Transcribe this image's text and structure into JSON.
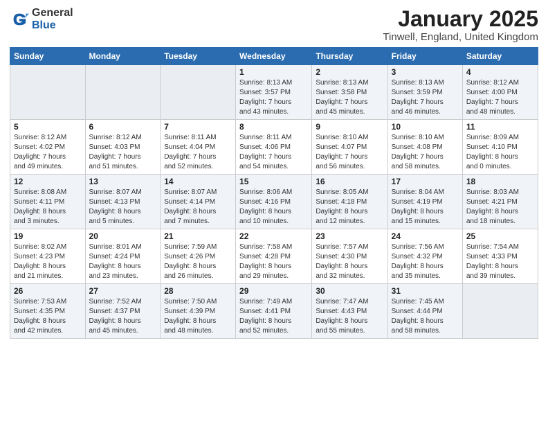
{
  "header": {
    "logo_general": "General",
    "logo_blue": "Blue",
    "month": "January 2025",
    "location": "Tinwell, England, United Kingdom"
  },
  "days_of_week": [
    "Sunday",
    "Monday",
    "Tuesday",
    "Wednesday",
    "Thursday",
    "Friday",
    "Saturday"
  ],
  "weeks": [
    [
      {
        "day": "",
        "info": ""
      },
      {
        "day": "",
        "info": ""
      },
      {
        "day": "",
        "info": ""
      },
      {
        "day": "1",
        "info": "Sunrise: 8:13 AM\nSunset: 3:57 PM\nDaylight: 7 hours\nand 43 minutes."
      },
      {
        "day": "2",
        "info": "Sunrise: 8:13 AM\nSunset: 3:58 PM\nDaylight: 7 hours\nand 45 minutes."
      },
      {
        "day": "3",
        "info": "Sunrise: 8:13 AM\nSunset: 3:59 PM\nDaylight: 7 hours\nand 46 minutes."
      },
      {
        "day": "4",
        "info": "Sunrise: 8:12 AM\nSunset: 4:00 PM\nDaylight: 7 hours\nand 48 minutes."
      }
    ],
    [
      {
        "day": "5",
        "info": "Sunrise: 8:12 AM\nSunset: 4:02 PM\nDaylight: 7 hours\nand 49 minutes."
      },
      {
        "day": "6",
        "info": "Sunrise: 8:12 AM\nSunset: 4:03 PM\nDaylight: 7 hours\nand 51 minutes."
      },
      {
        "day": "7",
        "info": "Sunrise: 8:11 AM\nSunset: 4:04 PM\nDaylight: 7 hours\nand 52 minutes."
      },
      {
        "day": "8",
        "info": "Sunrise: 8:11 AM\nSunset: 4:06 PM\nDaylight: 7 hours\nand 54 minutes."
      },
      {
        "day": "9",
        "info": "Sunrise: 8:10 AM\nSunset: 4:07 PM\nDaylight: 7 hours\nand 56 minutes."
      },
      {
        "day": "10",
        "info": "Sunrise: 8:10 AM\nSunset: 4:08 PM\nDaylight: 7 hours\nand 58 minutes."
      },
      {
        "day": "11",
        "info": "Sunrise: 8:09 AM\nSunset: 4:10 PM\nDaylight: 8 hours\nand 0 minutes."
      }
    ],
    [
      {
        "day": "12",
        "info": "Sunrise: 8:08 AM\nSunset: 4:11 PM\nDaylight: 8 hours\nand 3 minutes."
      },
      {
        "day": "13",
        "info": "Sunrise: 8:07 AM\nSunset: 4:13 PM\nDaylight: 8 hours\nand 5 minutes."
      },
      {
        "day": "14",
        "info": "Sunrise: 8:07 AM\nSunset: 4:14 PM\nDaylight: 8 hours\nand 7 minutes."
      },
      {
        "day": "15",
        "info": "Sunrise: 8:06 AM\nSunset: 4:16 PM\nDaylight: 8 hours\nand 10 minutes."
      },
      {
        "day": "16",
        "info": "Sunrise: 8:05 AM\nSunset: 4:18 PM\nDaylight: 8 hours\nand 12 minutes."
      },
      {
        "day": "17",
        "info": "Sunrise: 8:04 AM\nSunset: 4:19 PM\nDaylight: 8 hours\nand 15 minutes."
      },
      {
        "day": "18",
        "info": "Sunrise: 8:03 AM\nSunset: 4:21 PM\nDaylight: 8 hours\nand 18 minutes."
      }
    ],
    [
      {
        "day": "19",
        "info": "Sunrise: 8:02 AM\nSunset: 4:23 PM\nDaylight: 8 hours\nand 21 minutes."
      },
      {
        "day": "20",
        "info": "Sunrise: 8:01 AM\nSunset: 4:24 PM\nDaylight: 8 hours\nand 23 minutes."
      },
      {
        "day": "21",
        "info": "Sunrise: 7:59 AM\nSunset: 4:26 PM\nDaylight: 8 hours\nand 26 minutes."
      },
      {
        "day": "22",
        "info": "Sunrise: 7:58 AM\nSunset: 4:28 PM\nDaylight: 8 hours\nand 29 minutes."
      },
      {
        "day": "23",
        "info": "Sunrise: 7:57 AM\nSunset: 4:30 PM\nDaylight: 8 hours\nand 32 minutes."
      },
      {
        "day": "24",
        "info": "Sunrise: 7:56 AM\nSunset: 4:32 PM\nDaylight: 8 hours\nand 35 minutes."
      },
      {
        "day": "25",
        "info": "Sunrise: 7:54 AM\nSunset: 4:33 PM\nDaylight: 8 hours\nand 39 minutes."
      }
    ],
    [
      {
        "day": "26",
        "info": "Sunrise: 7:53 AM\nSunset: 4:35 PM\nDaylight: 8 hours\nand 42 minutes."
      },
      {
        "day": "27",
        "info": "Sunrise: 7:52 AM\nSunset: 4:37 PM\nDaylight: 8 hours\nand 45 minutes."
      },
      {
        "day": "28",
        "info": "Sunrise: 7:50 AM\nSunset: 4:39 PM\nDaylight: 8 hours\nand 48 minutes."
      },
      {
        "day": "29",
        "info": "Sunrise: 7:49 AM\nSunset: 4:41 PM\nDaylight: 8 hours\nand 52 minutes."
      },
      {
        "day": "30",
        "info": "Sunrise: 7:47 AM\nSunset: 4:43 PM\nDaylight: 8 hours\nand 55 minutes."
      },
      {
        "day": "31",
        "info": "Sunrise: 7:45 AM\nSunset: 4:44 PM\nDaylight: 8 hours\nand 58 minutes."
      },
      {
        "day": "",
        "info": ""
      }
    ]
  ]
}
